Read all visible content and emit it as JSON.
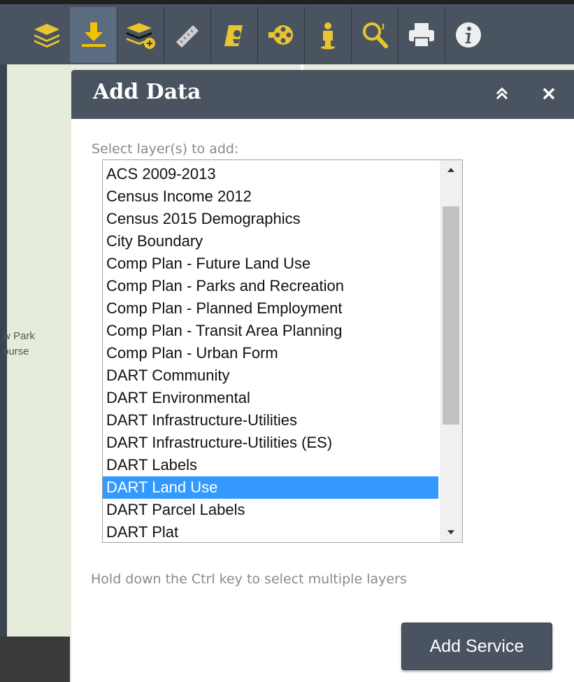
{
  "toolbar": {
    "tools": [
      {
        "icon": "layers-icon"
      },
      {
        "icon": "download-icon",
        "active": true
      },
      {
        "icon": "add-layer-icon"
      },
      {
        "icon": "ruler-icon"
      },
      {
        "icon": "street-view-icon"
      },
      {
        "icon": "theater-icon"
      },
      {
        "icon": "pegman-icon"
      },
      {
        "icon": "search-icon"
      },
      {
        "icon": "print-icon"
      },
      {
        "icon": "info-icon"
      }
    ],
    "accent_color": "#e8c431"
  },
  "map": {
    "label_line1": "w Park",
    "label_line2": "ourse"
  },
  "panel": {
    "title": "Add Data",
    "select_label": "Select layer(s) to add:",
    "layers": [
      "ACS 2009-2013",
      "Census Income 2012",
      "Census 2015 Demographics",
      "City Boundary",
      "Comp Plan - Future Land Use",
      "Comp Plan - Parks and Recreation",
      "Comp Plan - Planned Employment",
      "Comp Plan - Transit Area Planning",
      "Comp Plan - Urban Form",
      "DART Community",
      "DART Environmental",
      "DART Infrastructure-Utilities",
      "DART Infrastructure-Utilities (ES)",
      "DART Labels",
      "DART Land Use",
      "DART Parcel Labels",
      "DART Plat"
    ],
    "selected_layer": "DART Land Use",
    "hint": "Hold down the Ctrl key to select multiple layers",
    "add_button": "Add Service",
    "selection_color": "#3399ff"
  }
}
